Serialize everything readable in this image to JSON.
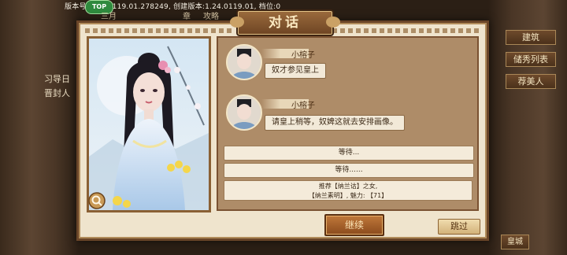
{
  "background": {
    "version_text": "版本号:1.24.0119.01.278249, 创建版本:1.24.0119.01, 档位:0",
    "coin_badge": "TOP",
    "top_tabs": [
      "三月",
      "章",
      "攻略"
    ],
    "right_tabs": [
      "建筑",
      "储秀列表",
      "荐美人"
    ],
    "left_items": [
      "习导日",
      "晋封人"
    ],
    "bottom_right_label": "皇城"
  },
  "dialog": {
    "title": "对话",
    "messages": [
      {
        "speaker": "小榕子",
        "text": "奴才参见皇上"
      },
      {
        "speaker": "小榕子",
        "text": "请皇上稍等，奴婢这就去安排画像。"
      }
    ],
    "options": [
      {
        "label": "等待..."
      },
      {
        "label": "等待......"
      }
    ],
    "recommendation": {
      "line1": "推荐【纳兰诂】之女,",
      "line2": "【纳兰素明】, 魅力: 【71】"
    },
    "continue_label": "继续",
    "skip_label": "跳过"
  },
  "colors": {
    "panel": "#efe4cd",
    "chat_bg": "#ae8c68",
    "accent_brown": "#6a4528",
    "continue_button": "#a85f2a"
  }
}
